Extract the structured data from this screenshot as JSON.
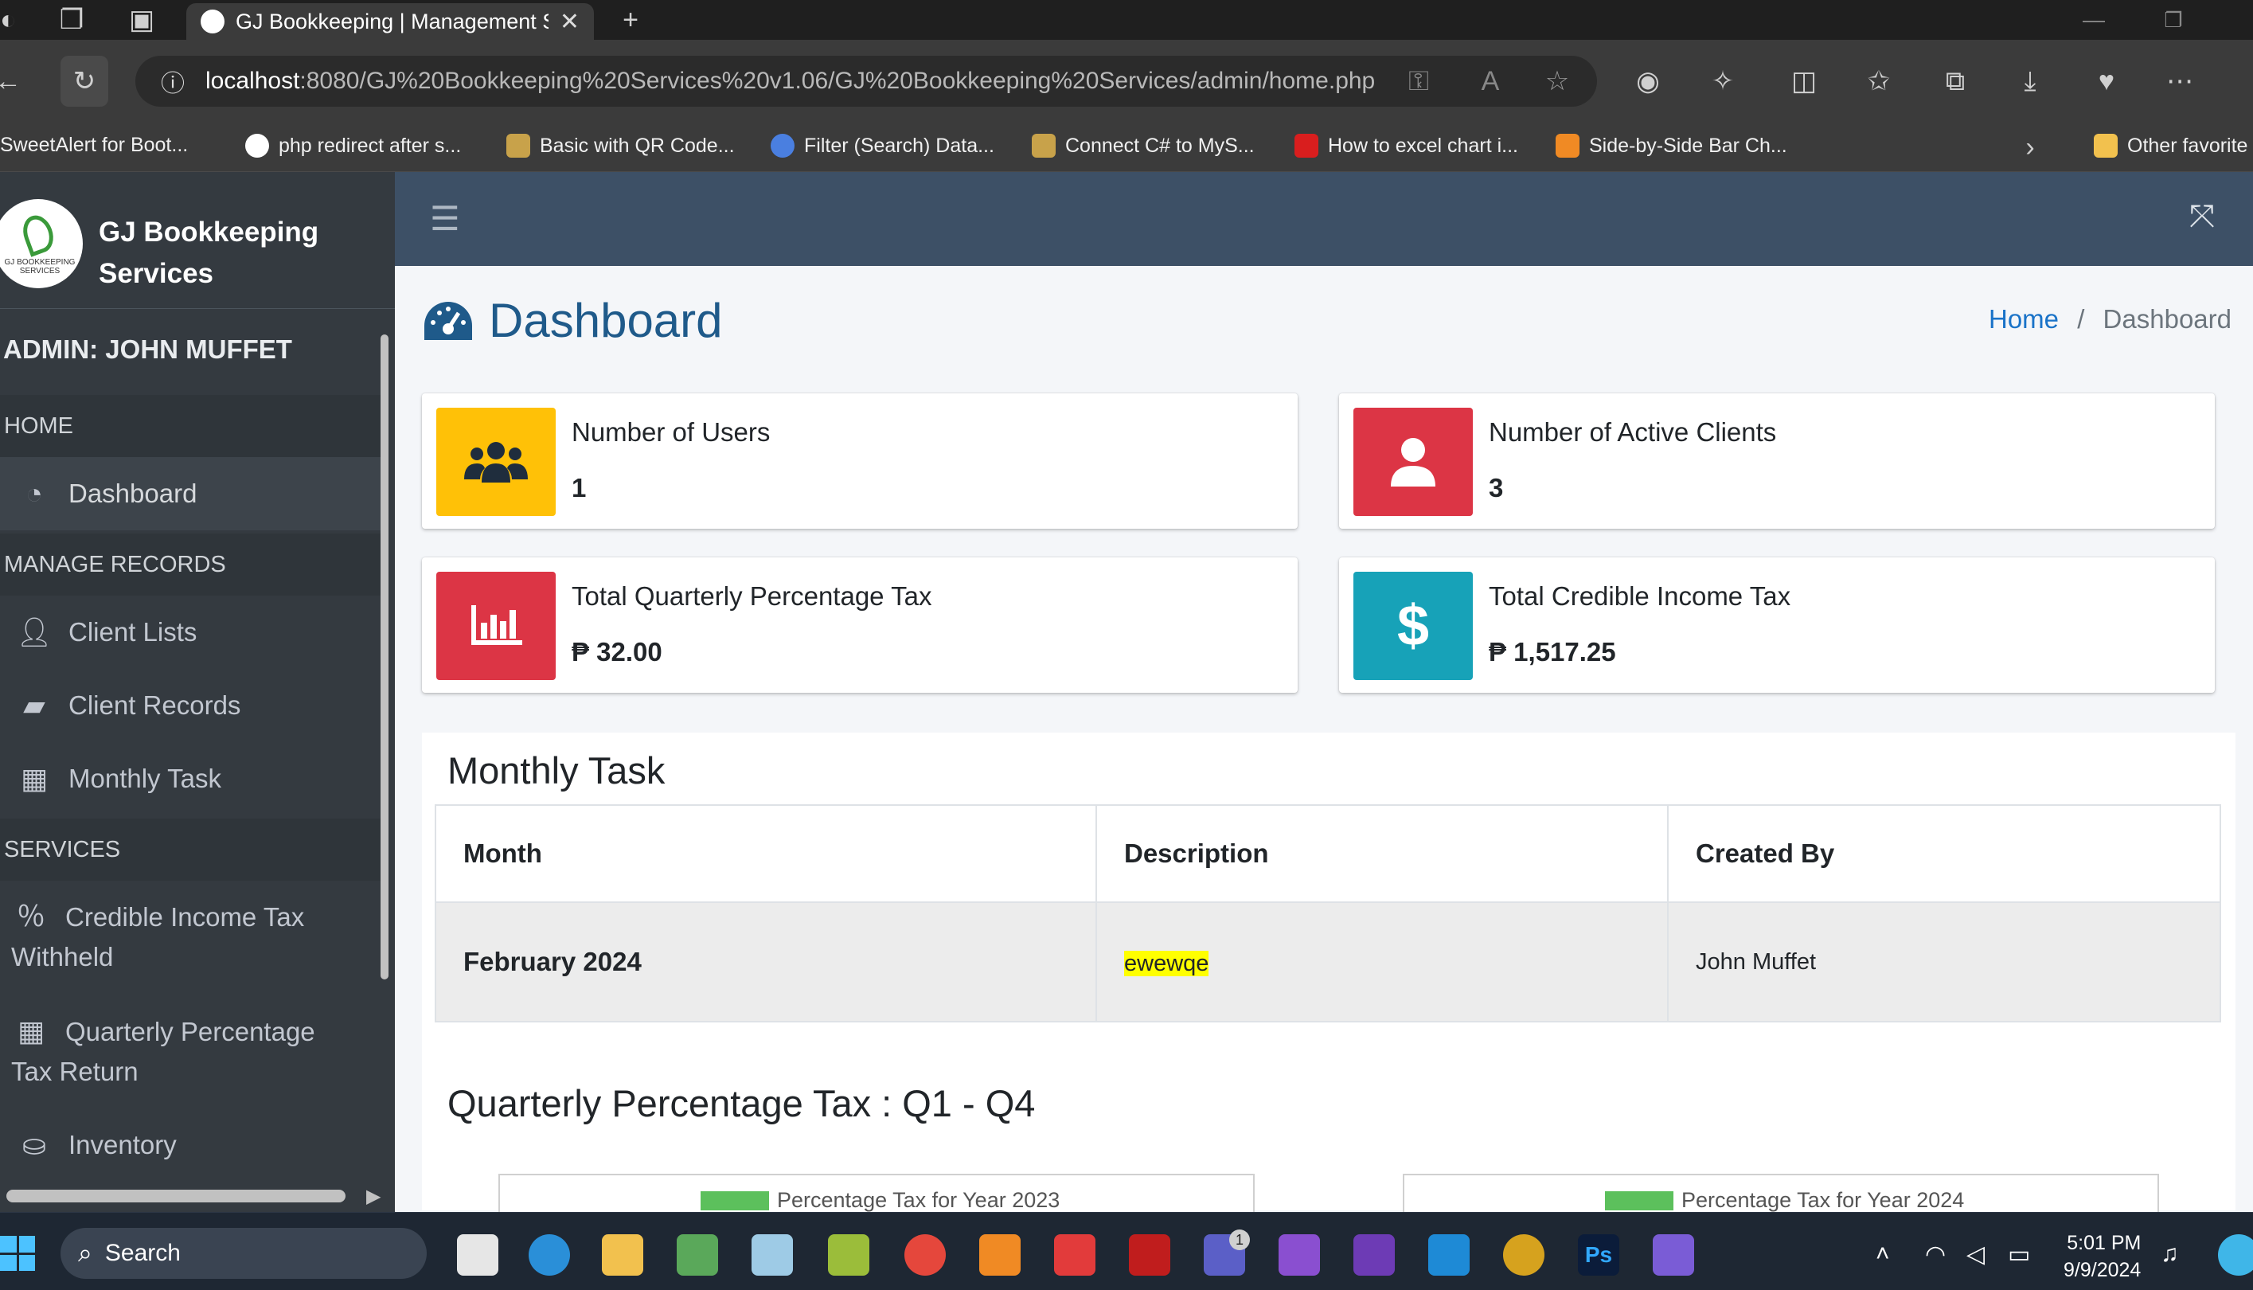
{
  "browser": {
    "tab_title": "GJ Bookkeeping | Management Sy",
    "url_host": "localhost",
    "url_path": ":8080/GJ%20Bookkeeping%20Services%20v1.06/GJ%20Bookkeeping%20Services/admin/home.php",
    "bookmarks": [
      {
        "label": "SweetAlert for Boot...",
        "color": "#1f1f1f"
      },
      {
        "label": "php redirect after s...",
        "color": "#ffffff"
      },
      {
        "label": "Basic with QR Code...",
        "color": "#c8a24a"
      },
      {
        "label": "Filter (Search) Data...",
        "color": "#4a7fe0"
      },
      {
        "label": "Connect C# to MyS...",
        "color": "#c8a24a"
      },
      {
        "label": "How to excel chart i...",
        "color": "#d91e1e"
      },
      {
        "label": "Side-by-Side Bar Ch...",
        "color": "#f08a24"
      }
    ],
    "other_favorites": "Other favorite"
  },
  "sidebar": {
    "brand_line1": "GJ Bookkeeping",
    "brand_line2": "Services",
    "logo_caption": "GJ BOOKKEEPING SERVICES",
    "admin": "ADMIN: JOHN MUFFET",
    "headers": {
      "home": "HOME",
      "manage": "MANAGE RECORDS",
      "services": "SERVICES"
    },
    "items": {
      "dashboard": "Dashboard",
      "client_lists": "Client Lists",
      "client_records": "Client Records",
      "monthly_task": "Monthly Task",
      "credible_income_l1": "Credible Income Tax",
      "credible_income_l2": "Withheld",
      "quarterly_l1": "Quarterly Percentage",
      "quarterly_l2": "Tax Return",
      "inventory": "Inventory"
    }
  },
  "main": {
    "title": "Dashboard",
    "breadcrumb": {
      "home": "Home",
      "sep": "/",
      "current": "Dashboard"
    },
    "boxes": [
      {
        "label": "Number of Users",
        "value": "1",
        "color": "#ffc107"
      },
      {
        "label": "Number of Active Clients",
        "value": "3",
        "color": "#dc3545"
      },
      {
        "label": "Total Quarterly Percentage Tax",
        "value": "₱ 32.00",
        "color": "#dc3545"
      },
      {
        "label": "Total Credible Income Tax",
        "value": "₱ 1,517.25",
        "color": "#17a2b8"
      }
    ],
    "monthly_task": {
      "title": "Monthly Task",
      "columns": [
        "Month",
        "Description",
        "Created By"
      ],
      "rows": [
        [
          "February 2024",
          "ewewqe",
          "John Muffet"
        ]
      ]
    },
    "quarterly": {
      "title": "Quarterly Percentage Tax : Q1 - Q4",
      "chart1_legend": "Percentage Tax for Year 2023",
      "chart2_legend": "Percentage Tax for Year 2024",
      "legend_color": "#5cc05c"
    }
  },
  "taskbar": {
    "search": "Search",
    "time": "5:01 PM",
    "date": "9/9/2024",
    "teams_badge": "1",
    "ps_label": "Ps"
  }
}
